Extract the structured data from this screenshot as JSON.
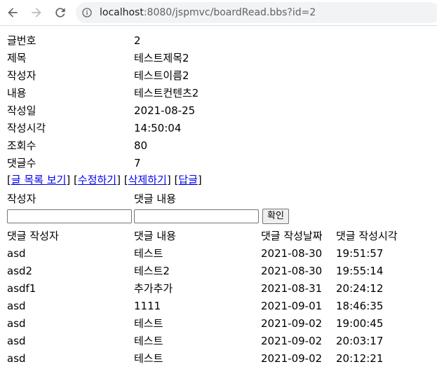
{
  "browser": {
    "url_host": "localhost",
    "url_rest": ":8080/jspmvc/boardRead.bbs?id=2"
  },
  "post": {
    "rows": [
      {
        "label": "글번호",
        "value": "2"
      },
      {
        "label": "제목",
        "value": "테스트제목2"
      },
      {
        "label": "작성자",
        "value": "테스트이름2"
      },
      {
        "label": "내용",
        "value": "테스트컨텐츠2"
      },
      {
        "label": "작성일",
        "value": "2021-08-25"
      },
      {
        "label": "작성시각",
        "value": "14:50:04"
      },
      {
        "label": "조회수",
        "value": "80"
      },
      {
        "label": "댓글수",
        "value": "7"
      }
    ]
  },
  "actions": {
    "list": "글 목록 보기",
    "edit": "수정하기",
    "delete": "삭제하기",
    "reply": "답글"
  },
  "comment_form": {
    "writer_label": "작성자",
    "content_label": "댓글 내용",
    "writer_value": "",
    "content_value": "",
    "submit": "확인"
  },
  "comments": {
    "headers": [
      "댓글 작성자",
      "댓글 내용",
      "댓글 작성날짜",
      "댓글 작성시각"
    ],
    "rows": [
      [
        "asd",
        "테스트",
        "2021-08-30",
        "19:51:57"
      ],
      [
        "asd2",
        "테스트2",
        "2021-08-30",
        "19:55:14"
      ],
      [
        "asdf1",
        "추가추가",
        "2021-08-31",
        "20:24:12"
      ],
      [
        "asd",
        "1111",
        "2021-09-01",
        "18:46:35"
      ],
      [
        "asd",
        "테스트",
        "2021-09-02",
        "19:00:45"
      ],
      [
        "asd",
        "테스트",
        "2021-09-02",
        "20:03:17"
      ],
      [
        "asd",
        "테스트",
        "2021-09-02",
        "20:12:21"
      ]
    ]
  }
}
